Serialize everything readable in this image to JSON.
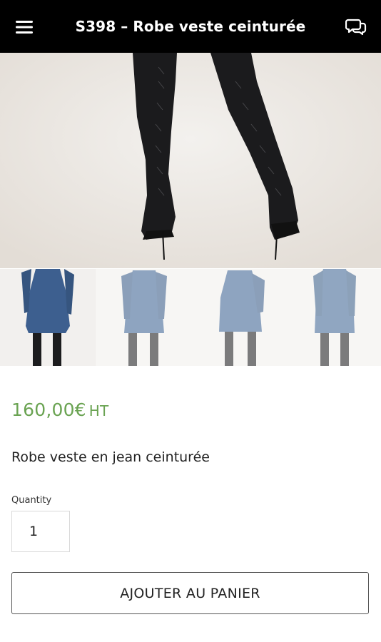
{
  "header": {
    "title": "S398 – Robe veste ceinturée",
    "menu_icon": "hamburger-menu-icon",
    "chat_icon": "chat-bubbles-icon",
    "background": "#000000"
  },
  "gallery": {
    "main_image": "boots-legs-photo",
    "thumbnails": [
      {
        "name": "denim-dress-front-photo",
        "selected": true
      },
      {
        "name": "denim-dress-front-belt-photo",
        "selected": false
      },
      {
        "name": "denim-dress-side-photo",
        "selected": false
      },
      {
        "name": "denim-dress-back-photo",
        "selected": false
      }
    ]
  },
  "product": {
    "price": "160,00€",
    "price_unit": "HT",
    "price_color": "#6aa352",
    "description": "Robe veste en jean ceinturée"
  },
  "quantity": {
    "label": "Quantity",
    "value": "1"
  },
  "cart_button": {
    "label": "AJOUTER AU PANIER"
  }
}
